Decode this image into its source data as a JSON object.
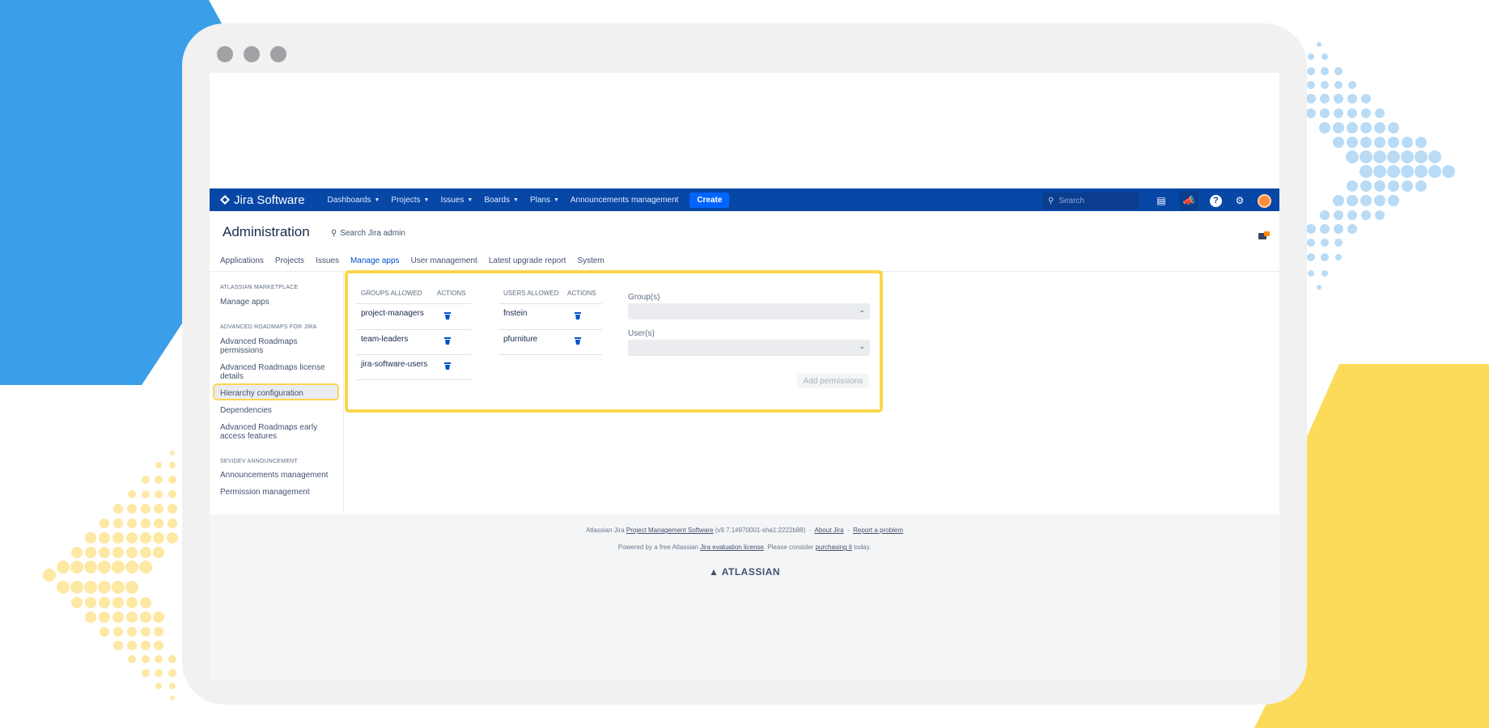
{
  "colors": {
    "accent_blue": "#0747a6",
    "highlight_yellow": "#f9d64f",
    "bg_blue": "#3b9ee8",
    "bg_yellow": "#fcdb5b"
  },
  "topnav": {
    "logo_text": "Jira Software",
    "items": [
      "Dashboards",
      "Projects",
      "Issues",
      "Boards",
      "Plans"
    ],
    "announcements": "Announcements management",
    "create_label": "Create",
    "search_placeholder": "Search",
    "icons": [
      "notes-icon",
      "announcement-icon",
      "help-icon",
      "settings-icon",
      "avatar"
    ]
  },
  "admin": {
    "title": "Administration",
    "search_label": "Search Jira admin",
    "tabs": [
      "Applications",
      "Projects",
      "Issues",
      "Manage apps",
      "User management",
      "Latest upgrade report",
      "System"
    ],
    "active_tab": "Manage apps"
  },
  "sidebar": {
    "sections": [
      {
        "heading": "ATLASSIAN MARKETPLACE",
        "items": [
          "Manage apps"
        ]
      },
      {
        "heading": "ADVANCED ROADMAPS FOR JIRA",
        "items": [
          "Advanced Roadmaps permissions",
          "Advanced Roadmaps license details",
          "Hierarchy configuration",
          "Dependencies",
          "Advanced Roadmaps early access features"
        ]
      },
      {
        "heading": "SEVIDEV ANNOUNCEMENT",
        "items": [
          "Announcements management",
          "Permission management"
        ]
      }
    ],
    "selected": "Permission management"
  },
  "groups_table": {
    "col_group": "GROUPS ALLOWED",
    "col_actions": "ACTIONS",
    "rows": [
      "project-managers",
      "team-leaders",
      "jira-software-users"
    ]
  },
  "users_table": {
    "col_user": "USERS ALLOWED",
    "col_actions": "ACTIONS",
    "rows": [
      "fnstein",
      "pfurniture"
    ]
  },
  "form": {
    "groups_label": "Group(s)",
    "users_label": "User(s)",
    "add_button": "Add permissions"
  },
  "footer": {
    "line1_prefix": "Atlassian Jira",
    "line1_link1": "Project Management Software",
    "line1_version": "(v9.7.1#970001-sha1:2222b88)",
    "line1_link2": "About Jira",
    "line1_link3": "Report a problem",
    "line2_prefix": "Powered by a free Atlassian",
    "line2_link1": "Jira evaluation license",
    "line2_middle": ". Please consider",
    "line2_link2": "purchasing it",
    "line2_suffix": "today.",
    "brand": "ATLASSIAN"
  }
}
